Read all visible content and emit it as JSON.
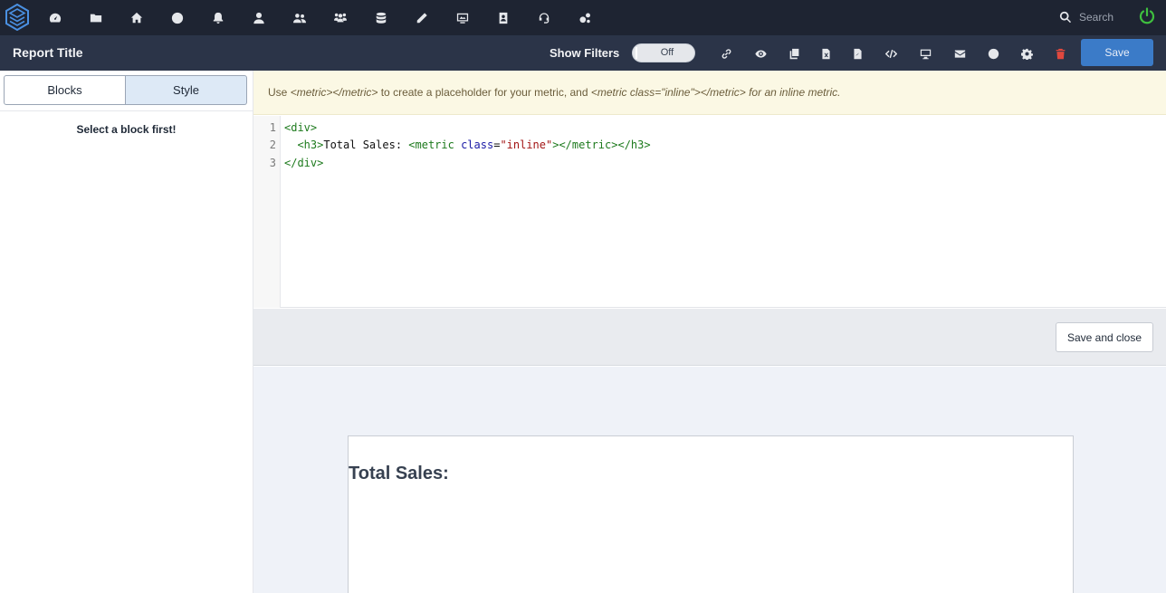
{
  "nav": {
    "icons": [
      "dashboard-icon",
      "folder-icon",
      "home-icon",
      "clock-icon",
      "bell-icon",
      "user-icon",
      "users-icon",
      "team-icon",
      "database-icon",
      "pencil-icon",
      "presentation-icon",
      "address-book-icon",
      "support-icon",
      "cogs-icon"
    ],
    "search_placeholder": "Search",
    "power_color": "#3fbf3f"
  },
  "toolbar": {
    "report_title": "Report Title",
    "show_filters_label": "Show Filters",
    "filters_toggle": "Off",
    "icons": [
      "link-icon",
      "eye-icon",
      "copy-icon",
      "excel-icon",
      "pdf-icon",
      "code-icon",
      "desktop-icon",
      "envelope-icon",
      "clock-icon",
      "gear-icon",
      "trash-icon"
    ],
    "save_label": "Save",
    "accent_color": "#3b7bc8",
    "trash_color": "#e0483e"
  },
  "left_panel": {
    "tabs": [
      {
        "label": "Blocks",
        "active": false
      },
      {
        "label": "Style",
        "active": true
      }
    ],
    "message": "Select a block first!"
  },
  "notice": {
    "use": "Use ",
    "code1": "<metric></metric>",
    "mid": " to create a placeholder for your metric, and ",
    "code2": "<metric class=\"inline\"></metric>",
    "end": " for an inline metric."
  },
  "editor": {
    "line_numbers": [
      "1",
      "2",
      "3"
    ],
    "lines": [
      [
        {
          "t": "tag",
          "v": "<div>"
        }
      ],
      [
        {
          "t": "plain",
          "v": "  "
        },
        {
          "t": "tag",
          "v": "<h3>"
        },
        {
          "t": "plain",
          "v": "Total Sales: "
        },
        {
          "t": "tag",
          "v": "<metric "
        },
        {
          "t": "attr",
          "v": "class"
        },
        {
          "t": "plain",
          "v": "="
        },
        {
          "t": "str",
          "v": "\"inline\""
        },
        {
          "t": "tag",
          "v": "></metric></h3>"
        }
      ],
      [
        {
          "t": "tag",
          "v": "</div>"
        }
      ]
    ]
  },
  "actions": {
    "save_close_label": "Save and close"
  },
  "preview": {
    "heading": "Total Sales:"
  }
}
